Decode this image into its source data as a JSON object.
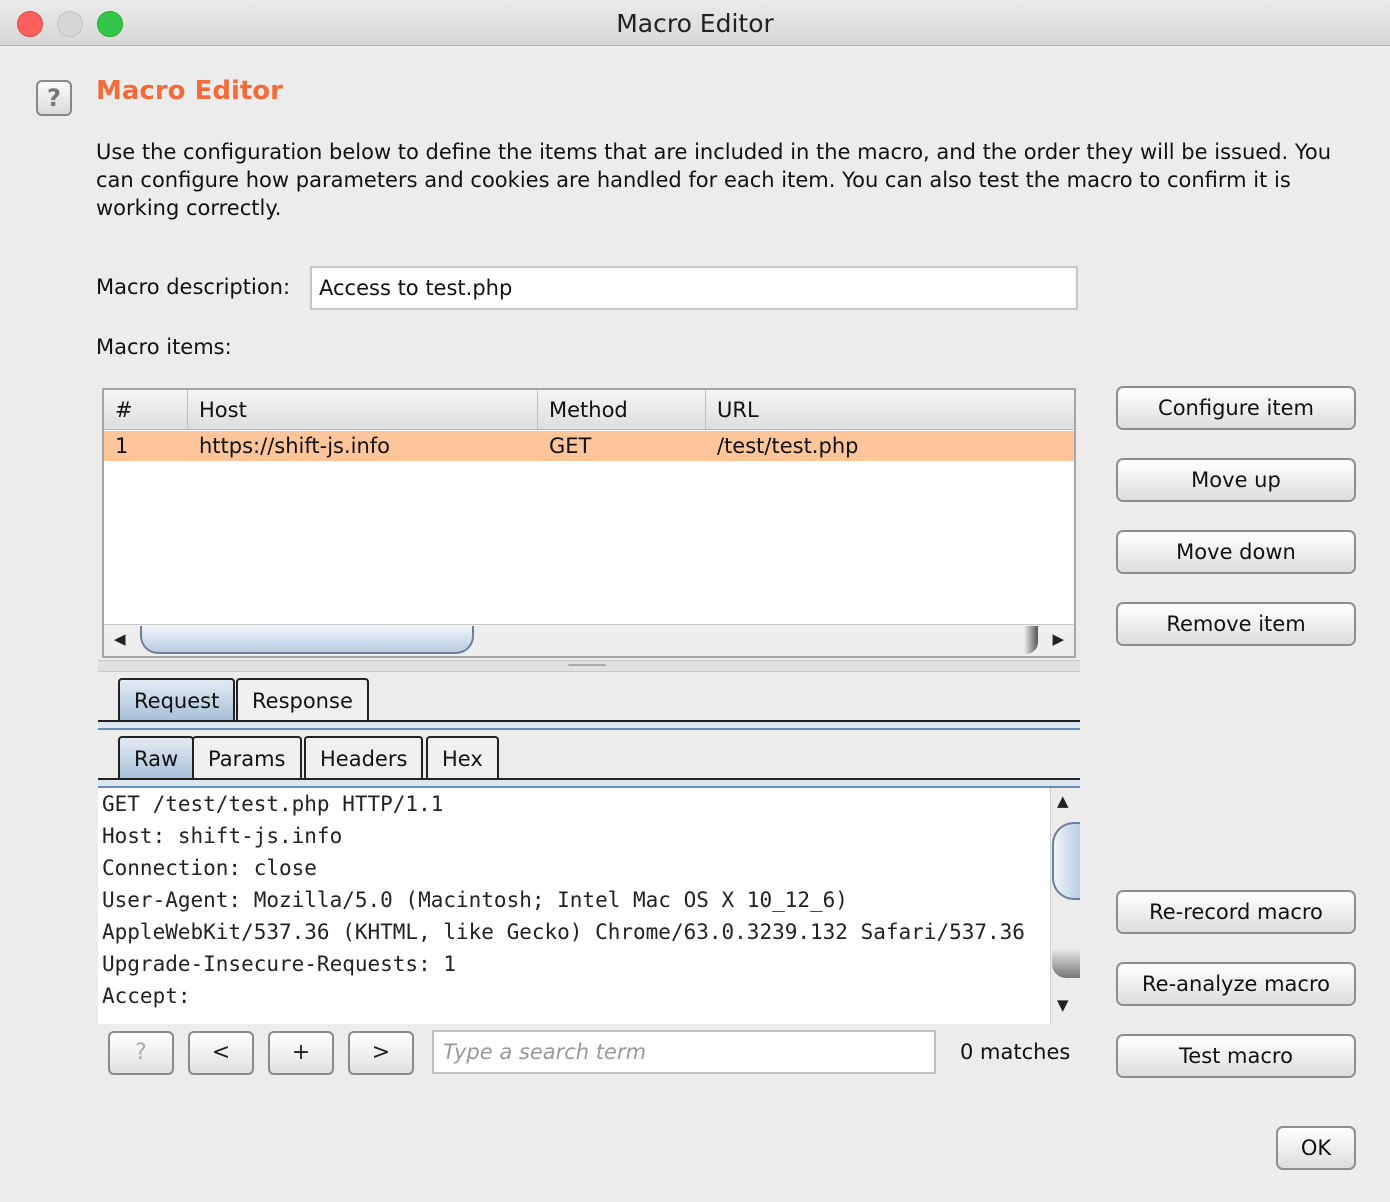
{
  "window": {
    "title": "Macro Editor"
  },
  "header": {
    "help_glyph": "?",
    "title": "Macro Editor",
    "description": "Use the configuration below to define the items that are included in the macro, and the order they will be issued. You can configure how parameters and cookies are handled for each item. You can also test the macro to confirm it is working correctly."
  },
  "macro": {
    "description_label": "Macro description:",
    "description_value": "Access to test.php",
    "items_label": "Macro items:"
  },
  "table": {
    "columns": [
      "#",
      "Host",
      "Method",
      "URL"
    ],
    "rows": [
      {
        "num": "1",
        "host": "https://shift-js.info",
        "method": "GET",
        "url": "/test/test.php"
      }
    ]
  },
  "item_buttons": {
    "configure": "Configure item",
    "move_up": "Move up",
    "move_down": "Move down",
    "remove": "Remove item"
  },
  "message_tabs": [
    "Request",
    "Response"
  ],
  "view_tabs": [
    "Raw",
    "Params",
    "Headers",
    "Hex"
  ],
  "raw_request": "GET /test/test.php HTTP/1.1\nHost: shift-js.info\nConnection: close\nUser-Agent: Mozilla/5.0 (Macintosh; Intel Mac OS X 10_12_6) AppleWebKit/537.36 (KHTML, like Gecko) Chrome/63.0.3239.132 Safari/537.36\nUpgrade-Insecure-Requests: 1\nAccept:",
  "search": {
    "help": "?",
    "prev": "<",
    "add": "+",
    "next": ">",
    "placeholder": "Type a search term",
    "matches": "0 matches"
  },
  "macro_buttons": {
    "rerecord": "Re-record macro",
    "reanalyze": "Re-analyze macro",
    "test": "Test macro"
  },
  "ok": "OK"
}
